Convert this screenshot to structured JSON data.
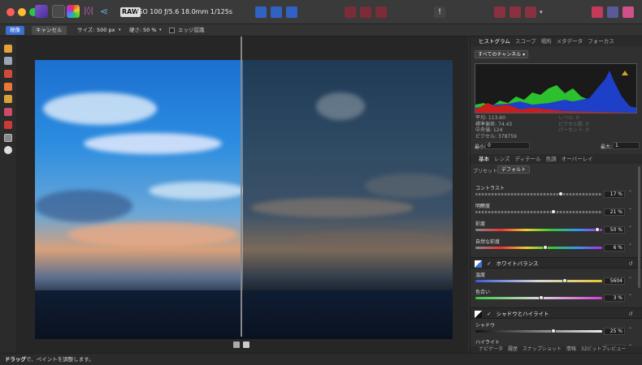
{
  "titlebar": {
    "raw_badge": "RAW",
    "exif": "ISO 100 ƒ/5.6 18.0mm 1/125s"
  },
  "toolbar": {
    "apply_label": "現像",
    "cancel_label": "キャンセル",
    "size_label": "サイズ:",
    "size_value": "500 px",
    "opacity_label": "硬さ:",
    "opacity_value": "50 %",
    "edge_label": "エッジ認識"
  },
  "status": {
    "bold": "ドラッグ",
    "text": "で、ペイントを調整します。"
  },
  "panel": {
    "top_tabs": [
      "ヒストグラム",
      "スコープ",
      "場所",
      "メタデータ",
      "フォーカス"
    ],
    "channel": "すべてのチャンネル",
    "stats_left": [
      "平均: 113.60",
      "標準偏差: 74.43",
      "中央値: 124",
      "ピクセル: 378759"
    ],
    "stats_right": [
      "レベル: 0",
      "ピクセル数: 0",
      "パーセント: 0"
    ],
    "range_min_label": "最小:",
    "range_min": "0",
    "range_max_label": "最大:",
    "range_max": "1",
    "mid_tabs": [
      "基本",
      "レンズ",
      "ディテール",
      "色調",
      "オーバーレイ"
    ],
    "preset_label": "プリセット:",
    "preset_value": "デフォルト",
    "sliders_basic": [
      {
        "label": "コントラスト",
        "value": "17 %",
        "pos": 0.68
      },
      {
        "label": "明瞭度",
        "value": "21 %",
        "pos": 0.62
      },
      {
        "label": "彩度",
        "value": "50 %",
        "pos": 0.98
      },
      {
        "label": "自然な彩度",
        "value": "6 %",
        "pos": 0.55
      }
    ],
    "wb_title": "ホワイトバランス",
    "sliders_wb": [
      {
        "label": "温度",
        "value": "5604",
        "pos": 0.71
      },
      {
        "label": "色合い",
        "value": "3 %",
        "pos": 0.52
      }
    ],
    "sh_title": "シャドウとハイライト",
    "sliders_sh": [
      {
        "label": "シャドウ",
        "value": "25 %",
        "pos": 0.62
      },
      {
        "label": "ハイライト",
        "value": "",
        "pos": 0.0
      }
    ],
    "bottom_tabs": [
      "ナビゲータ",
      "履歴",
      "スナップショット",
      "情報",
      "32ビットプレビュー"
    ]
  },
  "colors": {
    "accent": "#3b6fd4"
  }
}
